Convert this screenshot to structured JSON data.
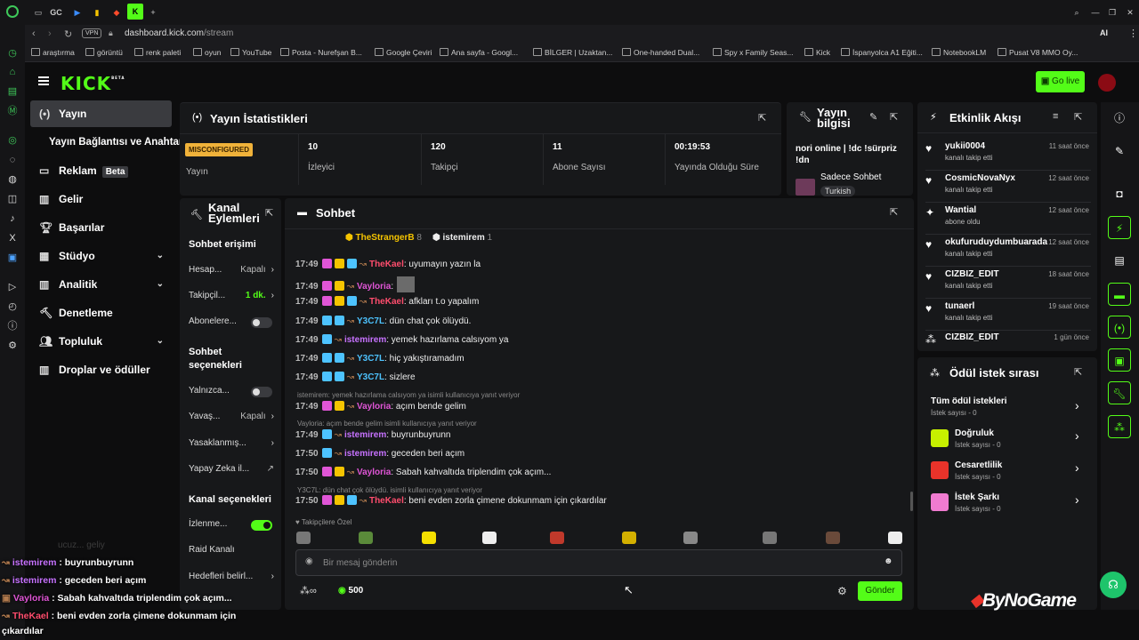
{
  "browser": {
    "url_host": "dashboard.kick.com",
    "url_path": "/stream",
    "vpn_label": "VPN",
    "tab_gc": "GC",
    "ai_label": "AI",
    "bookmarks": [
      "araştırma",
      "görüntü",
      "renk paleti",
      "oyun",
      "YouTube",
      "Posta - Nurefşan B...",
      "Google Çeviri",
      "Ana sayfa - Googl...",
      "BİLGER | Uzaktan...",
      "One-handed Dual...",
      "Spy x Family Seas...",
      "Kick",
      "İspanyolca A1 Eğiti...",
      "NotebookLM",
      "Pusat V8 MMO Oy..."
    ]
  },
  "header": {
    "logo": "KICK",
    "logo_beta": "BETA",
    "go_live": "Go live"
  },
  "sidebar": {
    "items": [
      {
        "label": "Yayın",
        "icon": "broadcast-icon"
      },
      {
        "label": "Yayın Bağlantısı ve Anahtarı"
      },
      {
        "label": "Reklam",
        "badge": "Beta",
        "icon": "monitor-icon"
      },
      {
        "label": "Gelir",
        "icon": "chart-icon"
      },
      {
        "label": "Başarılar",
        "icon": "trophy-icon"
      },
      {
        "label": "Stüdyo",
        "icon": "studio-icon"
      },
      {
        "label": "Analitik",
        "icon": "analytics-icon"
      },
      {
        "label": "Denetleme",
        "icon": "hammer-icon"
      },
      {
        "label": "Topluluk",
        "icon": "community-icon"
      },
      {
        "label": "Droplar ve ödüller",
        "icon": "drops-icon"
      }
    ]
  },
  "stats": {
    "title": "Yayın İstatistikleri",
    "status_badge": "MISCONFIGURED",
    "status_label": "Yayın",
    "items": [
      {
        "value": "10",
        "label": "İzleyici"
      },
      {
        "value": "120",
        "label": "Takipçi"
      },
      {
        "value": "11",
        "label": "Abone Sayısı"
      },
      {
        "value": "00:19:53",
        "label": "Yayında Olduğu Süre"
      }
    ]
  },
  "stream_info": {
    "title": "Yayın bilgisi",
    "stream_title": "nori online | !dc !sürpriz !dn",
    "category": "Sadece Sohbet",
    "tag": "Turkish"
  },
  "channel_actions": {
    "title": "Kanal Eylemleri",
    "chat_access_header": "Sohbet erişimi",
    "rows1": [
      {
        "label": "Hesap...",
        "value": "Kapalı"
      },
      {
        "label": "Takipçil...",
        "value": "1 dk."
      },
      {
        "label": "Abonelere..."
      }
    ],
    "chat_options_header": "Sohbet seçenekleri",
    "rows2": [
      {
        "label": "Yalnızca..."
      },
      {
        "label": "Yavaş...",
        "value": "Kapalı"
      },
      {
        "label": "Yasaklanmış..."
      },
      {
        "label": "Yapay Zeka il..."
      }
    ],
    "channel_options_header": "Kanal seçenekleri",
    "rows3": [
      {
        "label": "İzlenme..."
      },
      {
        "label": "Raid Kanalı"
      },
      {
        "label": "Hedefleri belirl..."
      }
    ]
  },
  "chat": {
    "title": "Sohbet",
    "pinned_users": [
      {
        "name": "TheStrangerB",
        "count": "8"
      },
      {
        "name": "istemirem",
        "count": "1"
      }
    ],
    "messages": [
      {
        "time": "17:49",
        "user": "TheKael",
        "color": "#ff4d6d",
        "text": ": uyumayın yazın la"
      },
      {
        "time": "17:49",
        "user": "Vayloria",
        "color": "#e055d6",
        "text": ":"
      },
      {
        "time": "17:49",
        "user": "TheKael",
        "color": "#ff4d6d",
        "text": ": afkları t.o yapalım"
      },
      {
        "time": "17:49",
        "user": "Y3C7L",
        "color": "#4dc3ff",
        "text": ": dün chat çok ölüydü."
      },
      {
        "time": "17:49",
        "user": "istemirem",
        "color": "#c772ff",
        "text": ": yemek hazırlama calsıyom ya"
      },
      {
        "time": "17:49",
        "user": "Y3C7L",
        "color": "#4dc3ff",
        "text": ": hiç yakıştıramadım"
      },
      {
        "time": "17:49",
        "user": "Y3C7L",
        "color": "#4dc3ff",
        "text": ": sizlere"
      },
      {
        "time": "17:49",
        "user": "Vayloria",
        "color": "#e055d6",
        "text": ": açım bende gelim"
      },
      {
        "time": "17:49",
        "user": "istemirem",
        "color": "#c772ff",
        "text": ": buyrunbuyrunn"
      },
      {
        "time": "17:50",
        "user": "istemirem",
        "color": "#c772ff",
        "text": ": geceden beri açım"
      },
      {
        "time": "17:50",
        "user": "Vayloria",
        "color": "#e055d6",
        "text": ": Sabah kahvaltıda triplendim çok açım..."
      },
      {
        "time": "17:50",
        "user": "TheKael",
        "color": "#ff4d6d",
        "text": ": beni evden zorla çimene dokunmam için çıkardılar"
      }
    ],
    "replies": [
      "istemirem: yemek hazırlama calsıyom ya isimli kullanıcıya yanıt veriyor",
      "Vayloria: açım bende gelim isimli kullanıcıya yanıt veriyor",
      "Y3C7L: dün chat çok ölüydü. isimli kullanıcıya yanıt veriyor"
    ],
    "followers_only": "Takipçilere Özel",
    "input_placeholder": "Bir mesaj gönderin",
    "points": "500",
    "send": "Gönder"
  },
  "activity": {
    "title": "Etkinlik Akışı",
    "events": [
      {
        "name": "yukii0004",
        "sub": "kanalı takip etti",
        "time": "11 saat önce",
        "icon": "heart-icon"
      },
      {
        "name": "CosmicNovaNyx",
        "sub": "kanalı takip etti",
        "time": "12 saat önce",
        "icon": "heart-icon"
      },
      {
        "name": "Wantial",
        "sub": "abone oldu",
        "time": "12 saat önce",
        "icon": "star-icon"
      },
      {
        "name": "okufuruduydumbuarada",
        "sub": "kanalı takip etti",
        "time": "12 saat önce",
        "icon": "heart-icon"
      },
      {
        "name": "CIZBIZ_EDIT",
        "sub": "kanalı takip etti",
        "time": "18 saat önce",
        "icon": "heart-icon"
      },
      {
        "name": "tunaerl",
        "sub": "kanalı takip etti",
        "time": "19 saat önce",
        "icon": "heart-icon"
      },
      {
        "name": "CIZBIZ_EDIT",
        "sub": "",
        "time": "1 gün önce",
        "icon": "reward-icon"
      }
    ]
  },
  "rewards": {
    "title": "Ödül istek sırası",
    "all": {
      "title": "Tüm ödül istekleri",
      "sub": "İstek sayısı - 0"
    },
    "items": [
      {
        "title": "Doğruluk",
        "sub": "İstek sayısı - 0",
        "color": "#c7f000"
      },
      {
        "title": "Cesaretlilik",
        "sub": "İstek sayısı - 0",
        "color": "#e8332a"
      },
      {
        "title": "İstek Şarkı",
        "sub": "İstek sayısı - 0",
        "color": "#f07bd0"
      }
    ]
  },
  "overlay": {
    "faded": "ucuz... geliy",
    "lines": [
      {
        "user": "istemirem",
        "color": "#c772ff",
        "text": " : buyrunbuyrunn"
      },
      {
        "user": "istemirem",
        "color": "#c772ff",
        "text": " : geceden beri açım"
      },
      {
        "user": "Vayloria",
        "color": "#e055d6",
        "text": " : Sabah kahvaltıda triplendim çok açım..."
      },
      {
        "user": "TheKael",
        "color": "#ff4d6d",
        "text": " : beni evden zorla çimene dokunmam için"
      },
      {
        "user": "",
        "color": "#fff",
        "text": "çıkardılar"
      }
    ]
  },
  "watermark": "ByNoGame",
  "colors": {
    "accent": "#53fc18",
    "panel": "#17181a",
    "bg": "#0d0d0e"
  }
}
